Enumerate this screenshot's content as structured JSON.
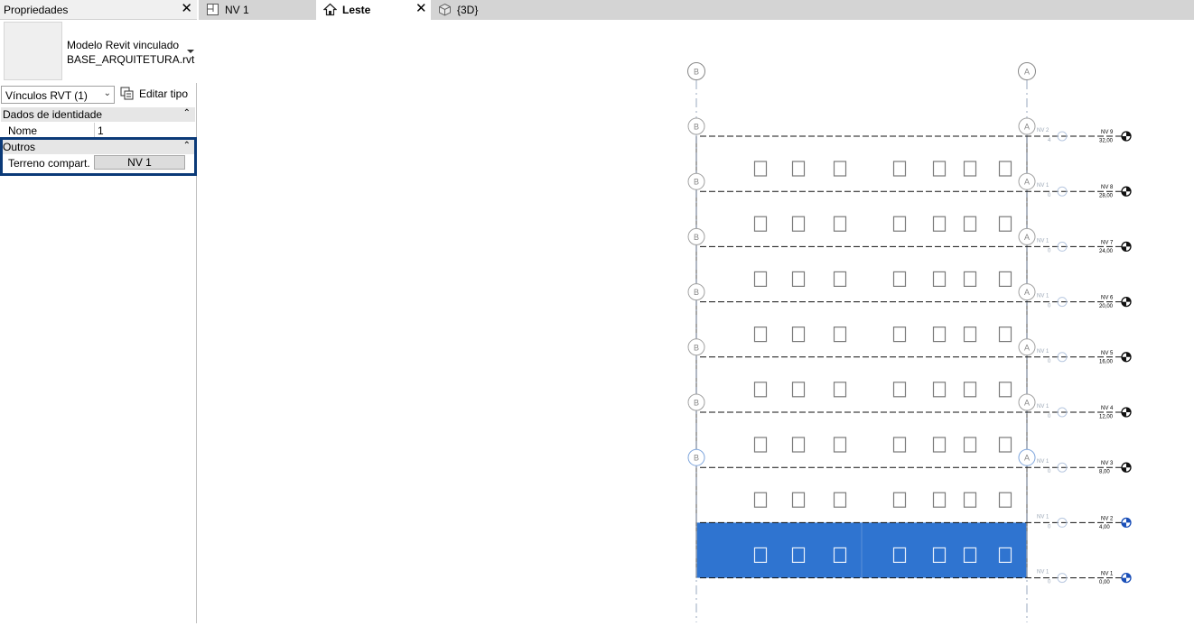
{
  "properties": {
    "title": "Propriedades",
    "type_family": "Modelo Revit vinculado",
    "type_name": "BASE_ARQUITETURA.rvt",
    "filter_value": "Vínculos RVT (1)",
    "edit_type_label": "Editar tipo",
    "groups": [
      {
        "label": "Dados de identidade",
        "rows": [
          {
            "key": "Nome",
            "value": "1"
          }
        ]
      },
      {
        "label": "Outros",
        "rows": [
          {
            "key": "Terreno compart.",
            "value": "NV 1"
          }
        ]
      }
    ]
  },
  "tabs": [
    {
      "label": "NV 1",
      "icon": "floor-plan-icon",
      "active": false
    },
    {
      "label": "Leste",
      "icon": "elevation-icon",
      "active": true
    },
    {
      "label": "{3D}",
      "icon": "cube-3d-icon",
      "active": false
    }
  ],
  "view": {
    "grids": [
      {
        "label": "B"
      },
      {
        "label": "A"
      }
    ],
    "levels": [
      {
        "name": "NV 9",
        "elevation": "32,00"
      },
      {
        "name": "NV 8",
        "elevation": "28,00"
      },
      {
        "name": "NV 7",
        "elevation": "24,00"
      },
      {
        "name": "NV 6",
        "elevation": "20,00"
      },
      {
        "name": "NV 5",
        "elevation": "16,00"
      },
      {
        "name": "NV 4",
        "elevation": "12,00"
      },
      {
        "name": "NV 3",
        "elevation": "8,00"
      },
      {
        "name": "NV 2",
        "elevation": "4,00"
      },
      {
        "name": "NV 1",
        "elevation": "0,00"
      }
    ],
    "ghost_labels": [
      {
        "name": "NV 2",
        "value": "4"
      },
      {
        "name": "NV 1",
        "value": "0"
      }
    ],
    "selection_color": "#2f74d0"
  }
}
